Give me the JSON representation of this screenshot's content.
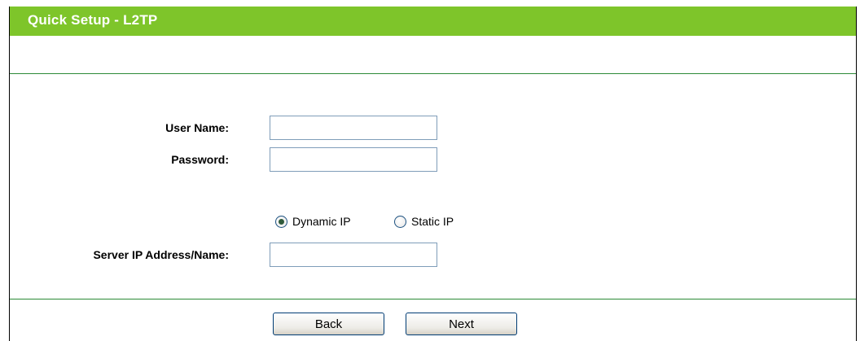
{
  "header": {
    "title": "Quick Setup - L2TP"
  },
  "form": {
    "username_label": "User Name:",
    "username_value": "",
    "password_label": "Password:",
    "password_value": "",
    "ip_mode": {
      "options": [
        "Dynamic IP",
        "Static IP"
      ],
      "selected": "Dynamic IP"
    },
    "server_label": "Server IP Address/Name:",
    "server_value": ""
  },
  "buttons": {
    "back": "Back",
    "next": "Next"
  },
  "colors": {
    "title_bar": "#7ec52a",
    "rule": "#2b8a37"
  }
}
